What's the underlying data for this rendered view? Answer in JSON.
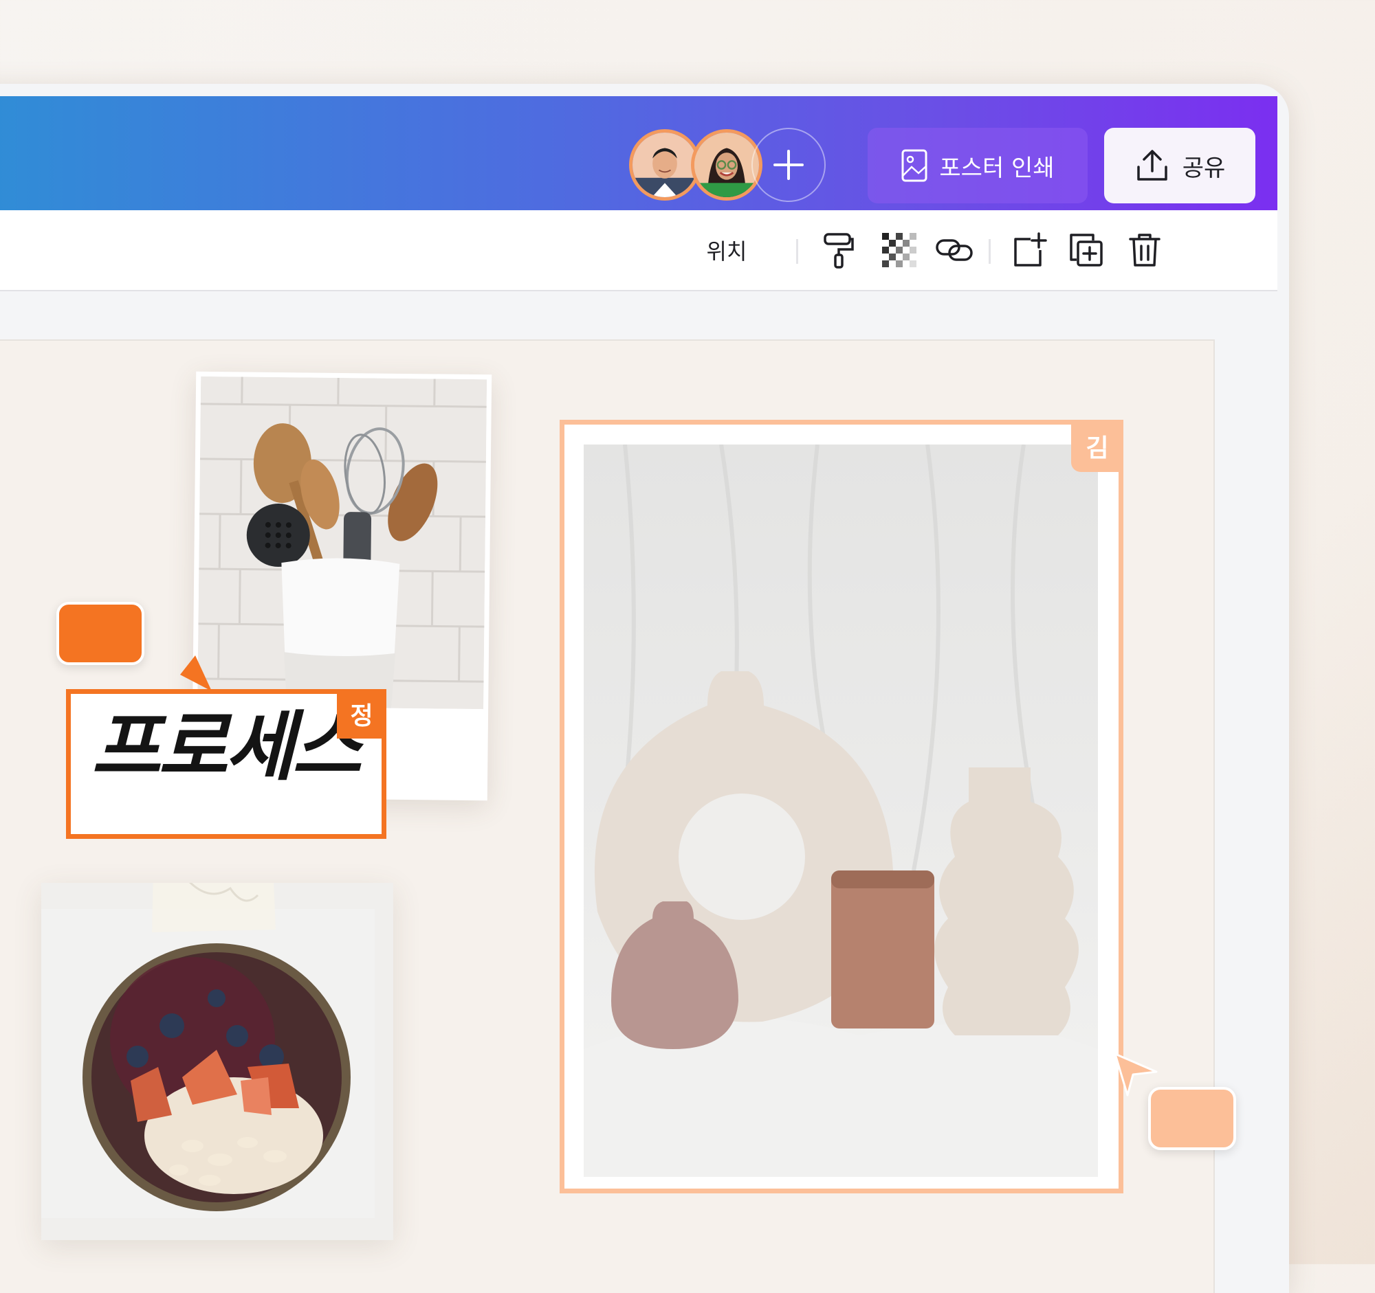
{
  "header": {
    "print_label": "포스터 인쇄",
    "share_label": "공유",
    "icons": {
      "add": "plus-icon",
      "print": "image-frame-icon",
      "share": "upload-icon"
    },
    "collaborators": [
      {
        "name": "avatar-man"
      },
      {
        "name": "avatar-woman"
      }
    ]
  },
  "toolbar": {
    "position_label": "위치",
    "icons": [
      "paint-roller-icon",
      "transparency-icon",
      "link-icon",
      "add-page-icon",
      "duplicate-icon",
      "trash-icon"
    ]
  },
  "canvas": {
    "handwriting_text": "프로세스",
    "tag_jeong": "정",
    "tag_kim": "김"
  },
  "colors": {
    "accent_orange": "#f47422",
    "accent_peach": "#fcbf98",
    "gradient_start": "#2f8ed6",
    "gradient_end": "#7b2ff0"
  }
}
